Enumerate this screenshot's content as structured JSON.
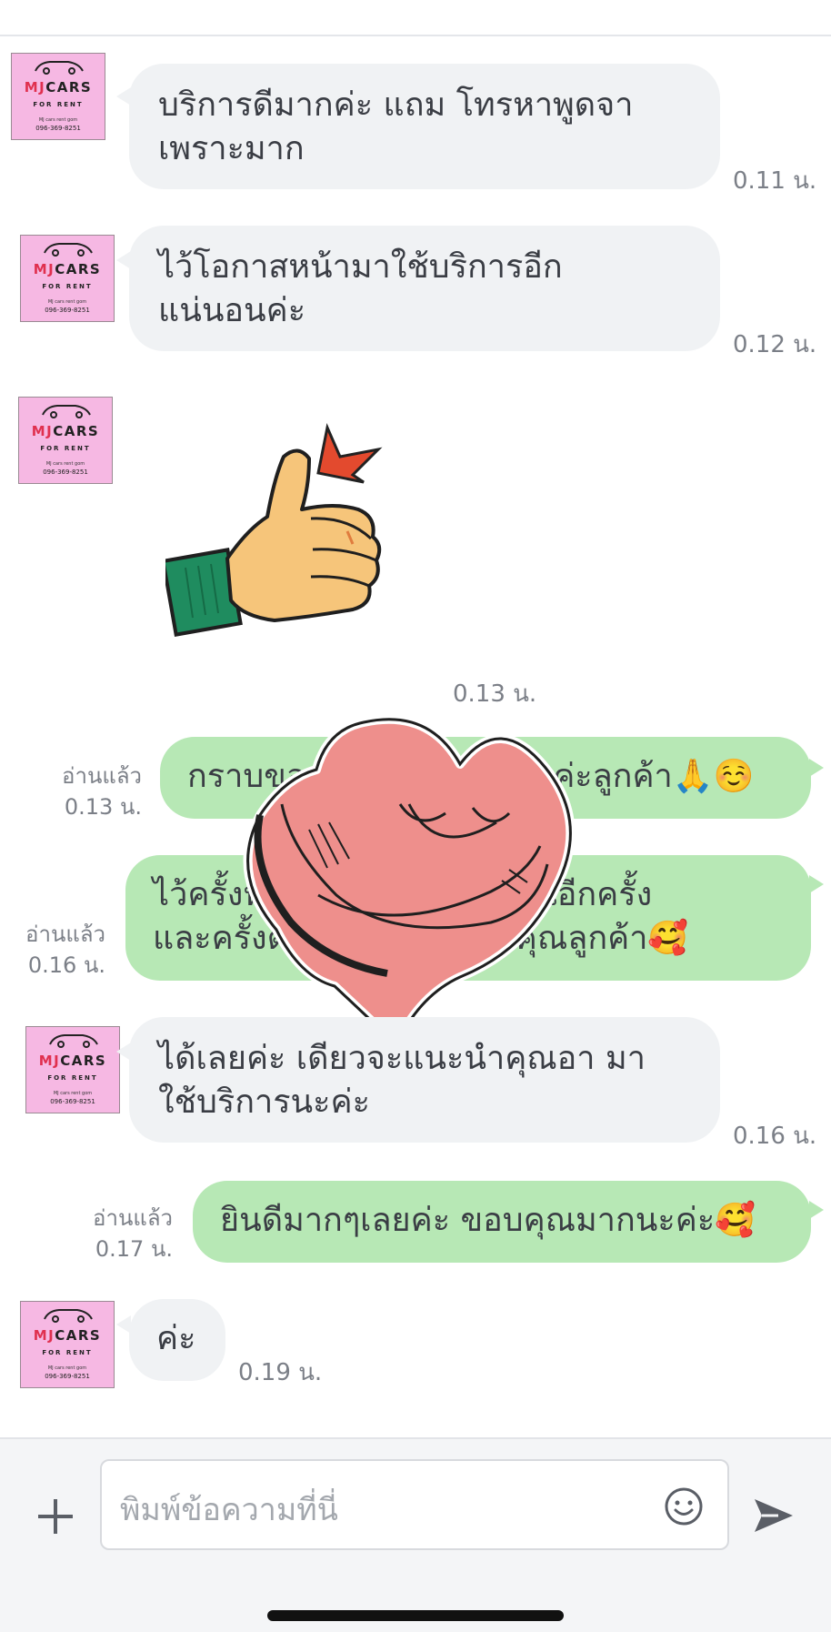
{
  "avatar": {
    "brand_mj": "MJ",
    "brand_cars": "CARS",
    "sub": "FOR RENT",
    "line1": "MJ cars rent gom",
    "phone": "096-369-8251"
  },
  "messages": [
    {
      "type": "incoming",
      "lines": [
        "บริการดีมากค่ะ แถม โทรหาพูดจา",
        "เพราะมาก"
      ],
      "time": "0.11 น."
    },
    {
      "type": "incoming",
      "lines": [
        "ไว้โอกาสหน้ามาใช้บริการอีก",
        "แน่นอนค่ะ"
      ],
      "time": "0.12 น."
    },
    {
      "type": "sticker",
      "name": "thumbs-up-sticker",
      "time": "0.13 น."
    },
    {
      "type": "outgoing",
      "lines": [
        "กราบขอบพระคุณมากๆนะค่ะลูกค้า🙏☺️"
      ],
      "read": "อ่านแล้ว",
      "time": "0.13 น."
    },
    {
      "type": "outgoing",
      "lines": [
        "ไว้ครั้งหน้าหวังว่าจะได้พบกันอีกครั้ง",
        "และครั้งต่อๆไปนะค่ะ ขอบคุณลูกค้า🥰"
      ],
      "read": "อ่านแล้ว",
      "time": "0.16 น."
    },
    {
      "type": "incoming",
      "lines": [
        "ได้เลยค่ะ เดียวจะแนะนำคุณอา มา",
        "ใช้บริการนะค่ะ"
      ],
      "time": "0.16 น."
    },
    {
      "type": "outgoing",
      "lines": [
        "ยินดีมากๆเลยค่ะ ขอบคุณมากนะค่ะ🥰"
      ],
      "read": "อ่านแล้ว",
      "time": "0.17 น."
    },
    {
      "type": "incoming",
      "lines": [
        "ค่ะ"
      ],
      "time": "0.19 น."
    }
  ],
  "input": {
    "placeholder": "พิมพ์ข้อความที่นี่"
  },
  "colors": {
    "incoming_bubble": "#f0f2f4",
    "outgoing_bubble": "#b7e8b5",
    "avatar_bg": "#f6b8e3",
    "heart": "#ee8f8c"
  },
  "icons": [
    "plus-icon",
    "smiley-icon",
    "send-icon",
    "thumbs-up-sticker",
    "hug-heart-sticker"
  ]
}
